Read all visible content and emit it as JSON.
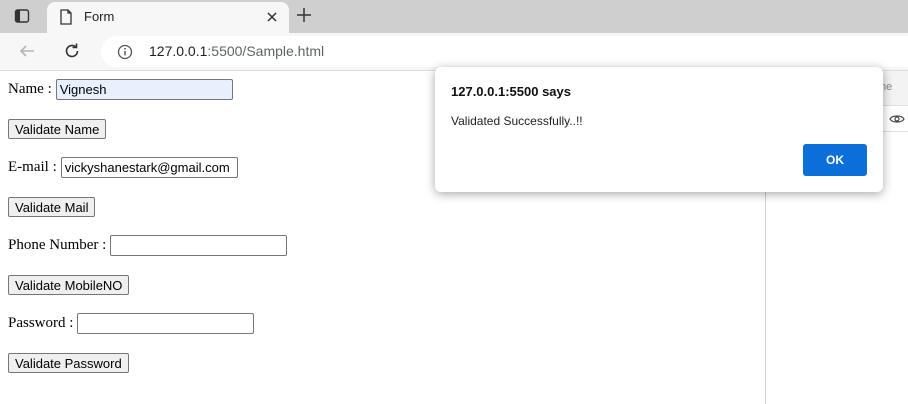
{
  "browser": {
    "tab_title": "Form",
    "url_host": "127.0.0.1",
    "url_rest": ":5500/Sample.html"
  },
  "form": {
    "name_label": "Name :",
    "name_value": "Vignesh",
    "validate_name": "Validate Name",
    "email_label": "E-mail :",
    "email_value": "vickyshanestark@gmail.com",
    "validate_mail": "Validate Mail",
    "phone_label": "Phone Number :",
    "phone_value": "",
    "validate_mobile": "Validate MobileNO",
    "password_label": "Password :",
    "password_value": "",
    "validate_password": "Validate Password"
  },
  "dialog": {
    "heading": "127.0.0.1:5500 says",
    "message": "Validated Successfully..!!",
    "ok_label": "OK"
  },
  "devtools": {
    "column_fragment": "me"
  },
  "colors": {
    "accent": "#0a6fd8",
    "autofill": "#e8f0fe"
  },
  "icons": {
    "sidebar": "sidebar-toggle-icon",
    "favicon": "page-icon",
    "close": "close-icon",
    "new_tab": "plus-icon",
    "back": "back-arrow-icon",
    "reload": "reload-icon",
    "info": "info-icon",
    "eye": "eye-icon"
  }
}
